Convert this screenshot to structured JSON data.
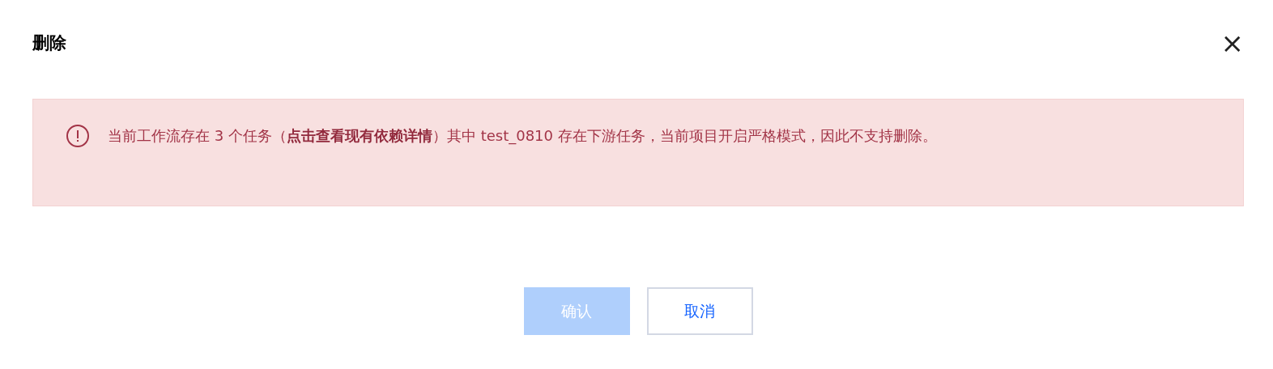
{
  "dialog": {
    "title": "删除",
    "close": "×"
  },
  "alert": {
    "message": "当前工作流存在 3 个任务（**点击查看现有依赖详情**）其中 test_0810 存在下游任务，当前项目开启严格模式，因此不支持删除。"
  },
  "buttons": [
    {
      "label": "确认",
      "kind": "primary",
      "disabled": true
    },
    {
      "label": "取消",
      "kind": "secondary",
      "disabled": false
    }
  ]
}
